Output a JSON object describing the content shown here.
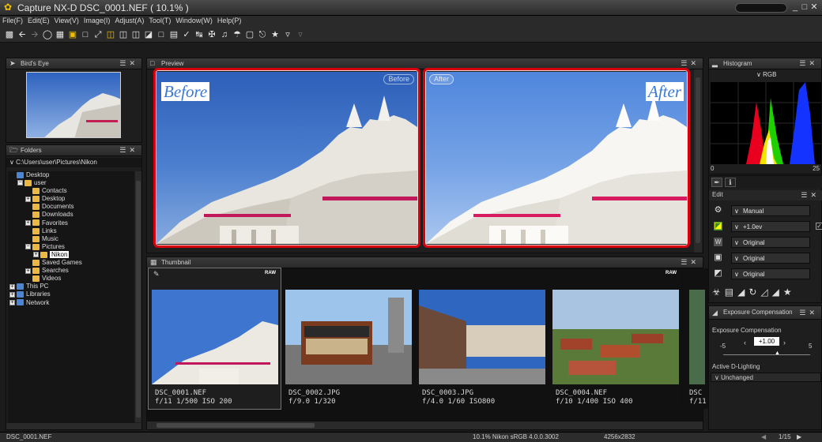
{
  "window": {
    "title": "Capture NX-D    DSC_0001.NEF ( 10.1% )",
    "controls": [
      "_",
      "□",
      "✕"
    ]
  },
  "menu": [
    "File(F)",
    "Edit(E)",
    "View(V)",
    "Image(I)",
    "Adjust(A)",
    "Tool(T)",
    "Window(W)",
    "Help(P)"
  ],
  "toolbar_icons": [
    "print-icon",
    "back-icon",
    "forward-icon",
    "rotate-icon",
    "grid-icon",
    "filmstrip-icon",
    "full-screen-icon",
    "fit-icon",
    "compare-icon",
    "compare-split-icon",
    "histogram-view-icon",
    "highlight-icon",
    "crop-icon",
    "straighten-icon",
    "dust-icon",
    "retouch-icon",
    "red-eye-icon",
    "color-picker-icon",
    "slideshow-icon",
    "label-icon",
    "rating-icon",
    "filter-icon",
    "filter-off-icon"
  ],
  "birds_eye": {
    "title": "Bird's Eye"
  },
  "folders": {
    "title": "Folders",
    "path": "C:\\Users\\user\\Pictures\\Nikon",
    "tree": [
      {
        "label": "Desktop",
        "level": 0,
        "expander": "",
        "icon": "b"
      },
      {
        "label": "user",
        "level": 1,
        "expander": "−",
        "icon": ""
      },
      {
        "label": "Contacts",
        "level": 2,
        "expander": "",
        "icon": ""
      },
      {
        "label": "Desktop",
        "level": 2,
        "expander": "+",
        "icon": ""
      },
      {
        "label": "Documents",
        "level": 2,
        "expander": "",
        "icon": ""
      },
      {
        "label": "Downloads",
        "level": 2,
        "expander": "",
        "icon": ""
      },
      {
        "label": "Favorites",
        "level": 2,
        "expander": "+",
        "icon": ""
      },
      {
        "label": "Links",
        "level": 2,
        "expander": "",
        "icon": ""
      },
      {
        "label": "Music",
        "level": 2,
        "expander": "",
        "icon": ""
      },
      {
        "label": "Pictures",
        "level": 2,
        "expander": "−",
        "icon": ""
      },
      {
        "label": "Nikon",
        "level": 3,
        "expander": "+",
        "icon": "",
        "selected": true
      },
      {
        "label": "Saved Games",
        "level": 2,
        "expander": "",
        "icon": ""
      },
      {
        "label": "Searches",
        "level": 2,
        "expander": "+",
        "icon": ""
      },
      {
        "label": "Videos",
        "level": 2,
        "expander": "",
        "icon": ""
      },
      {
        "label": "This PC",
        "level": 0,
        "expander": "+",
        "icon": "b"
      },
      {
        "label": "Libraries",
        "level": 0,
        "expander": "+",
        "icon": "b"
      },
      {
        "label": "Network",
        "level": 0,
        "expander": "+",
        "icon": "b"
      }
    ]
  },
  "preview": {
    "title": "Preview",
    "before_badge": "Before",
    "after_badge": "After",
    "before_label": "Before",
    "after_label": "After"
  },
  "thumbnail": {
    "title": "Thumbnail",
    "items": [
      {
        "name": "DSC_0001.NEF",
        "meta": "f/11 1/500 ISO 200",
        "raw": "RAW",
        "scene": "building"
      },
      {
        "name": "DSC_0002.JPG",
        "meta": "f/9.0 1/320",
        "raw": "",
        "scene": "tram"
      },
      {
        "name": "DSC_0003.JPG",
        "meta": "f/4.0 1/60 ISO800",
        "raw": "",
        "scene": "street"
      },
      {
        "name": "DSC_0004.NEF",
        "meta": "f/10 1/400 ISO 400",
        "raw": "RAW",
        "scene": "roofs"
      },
      {
        "name": "DSC",
        "meta": "f/11",
        "raw": "",
        "scene": "cut"
      }
    ]
  },
  "histogram": {
    "title": "Histogram",
    "channel": "RGB",
    "min": "0",
    "max": "25"
  },
  "edit": {
    "label": "Edit",
    "rows": [
      {
        "icon": "gear-icon",
        "glyph": "⚙",
        "value": "Manual"
      },
      {
        "icon": "exposure-icon",
        "glyph": "◪",
        "value": "+1.0ev"
      },
      {
        "icon": "white-balance-icon",
        "glyph": "W",
        "value": "Original"
      },
      {
        "icon": "picture-control-icon",
        "glyph": "▣",
        "value": "Original"
      },
      {
        "icon": "tone-icon",
        "glyph": "◩",
        "value": "Original"
      }
    ]
  },
  "exposure": {
    "title": "Exposure Compensation",
    "label": "Exposure Compensation",
    "value": "+1.00",
    "min": "-5",
    "max": "5",
    "adl_label": "Active D-Lighting",
    "adl_value": "Unchanged"
  },
  "status": {
    "file": "DSC_0001.NEF",
    "zoom_profile": "10.1%  Nikon sRGB 4.0.0.3002",
    "dimensions": "4256x2832",
    "page": "1/15"
  },
  "colors": {
    "highlight_red": "#d9000d",
    "sky": "#3f73c6",
    "label_blue": "#3a78d8"
  }
}
